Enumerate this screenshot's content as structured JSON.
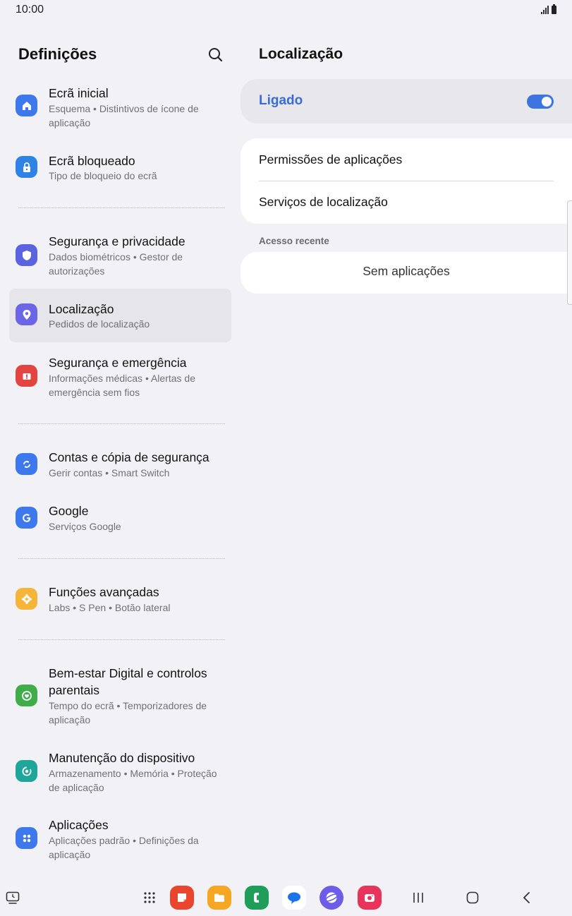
{
  "status_bar": {
    "time": "10:00"
  },
  "left_pane": {
    "title": "Definições",
    "items": [
      {
        "title": "Ecrã inicial",
        "subtitle": "Esquema  •  Distintivos de ícone de aplicação",
        "icon": "home-icon",
        "color": "#3d79ec"
      },
      {
        "title": "Ecrã bloqueado",
        "subtitle": "Tipo de bloqueio do ecrã",
        "icon": "lock-icon",
        "color": "#2f83e6"
      },
      {
        "title": "Segurança e privacidade",
        "subtitle": "Dados biométricos  •  Gestor de autorizações",
        "icon": "shield-icon",
        "color": "#5a62e0"
      },
      {
        "title": "Localização",
        "subtitle": "Pedidos de localização",
        "icon": "location-pin-icon",
        "color": "#6b66e6"
      },
      {
        "title": "Segurança e emergência",
        "subtitle": "Informações médicas  •  Alertas de emergência sem fios",
        "icon": "emergency-icon",
        "color": "#e2443f"
      },
      {
        "title": "Contas e cópia de segurança",
        "subtitle": "Gerir contas  •  Smart Switch",
        "icon": "sync-icon",
        "color": "#3d79ec"
      },
      {
        "title": "Google",
        "subtitle": "Serviços Google",
        "icon": "google-icon",
        "color": "#3d79ec"
      },
      {
        "title": "Funções avançadas",
        "subtitle": "Labs  •  S Pen  •  Botão lateral",
        "icon": "gear-plus-icon",
        "color": "#f5b53a"
      },
      {
        "title": "Bem-estar Digital e controlos parentais",
        "subtitle": "Tempo do ecrã  •  Temporizadores de aplicação",
        "icon": "wellbeing-icon",
        "color": "#3fae4a"
      },
      {
        "title": "Manutenção do dispositivo",
        "subtitle": "Armazenamento  •  Memória  •  Proteção de aplicação",
        "icon": "device-care-icon",
        "color": "#1fa69a"
      },
      {
        "title": "Aplicações",
        "subtitle": "Aplicações padrão  •  Definições da aplicação",
        "icon": "apps-grid-icon",
        "color": "#3d79ec"
      }
    ]
  },
  "right_pane": {
    "title": "Localização",
    "toggle_label": "Ligado",
    "toggle_on": true,
    "rows": [
      "Permissões de aplicações",
      "Serviços de localização"
    ],
    "section_label": "Acesso recente",
    "empty_text": "Sem aplicações"
  },
  "accent_color": "#3e74e0",
  "navbar": {
    "apps": [
      {
        "name": "samsung-notes-icon",
        "color": "#e8442e"
      },
      {
        "name": "my-files-icon",
        "color": "#f5a623"
      },
      {
        "name": "phone-icon",
        "color": "#1f9e5a"
      },
      {
        "name": "messages-icon",
        "color": "#ffffff"
      },
      {
        "name": "internet-icon",
        "color": "#6c5ce7"
      },
      {
        "name": "camera-icon",
        "color": "#e8345a"
      }
    ]
  }
}
